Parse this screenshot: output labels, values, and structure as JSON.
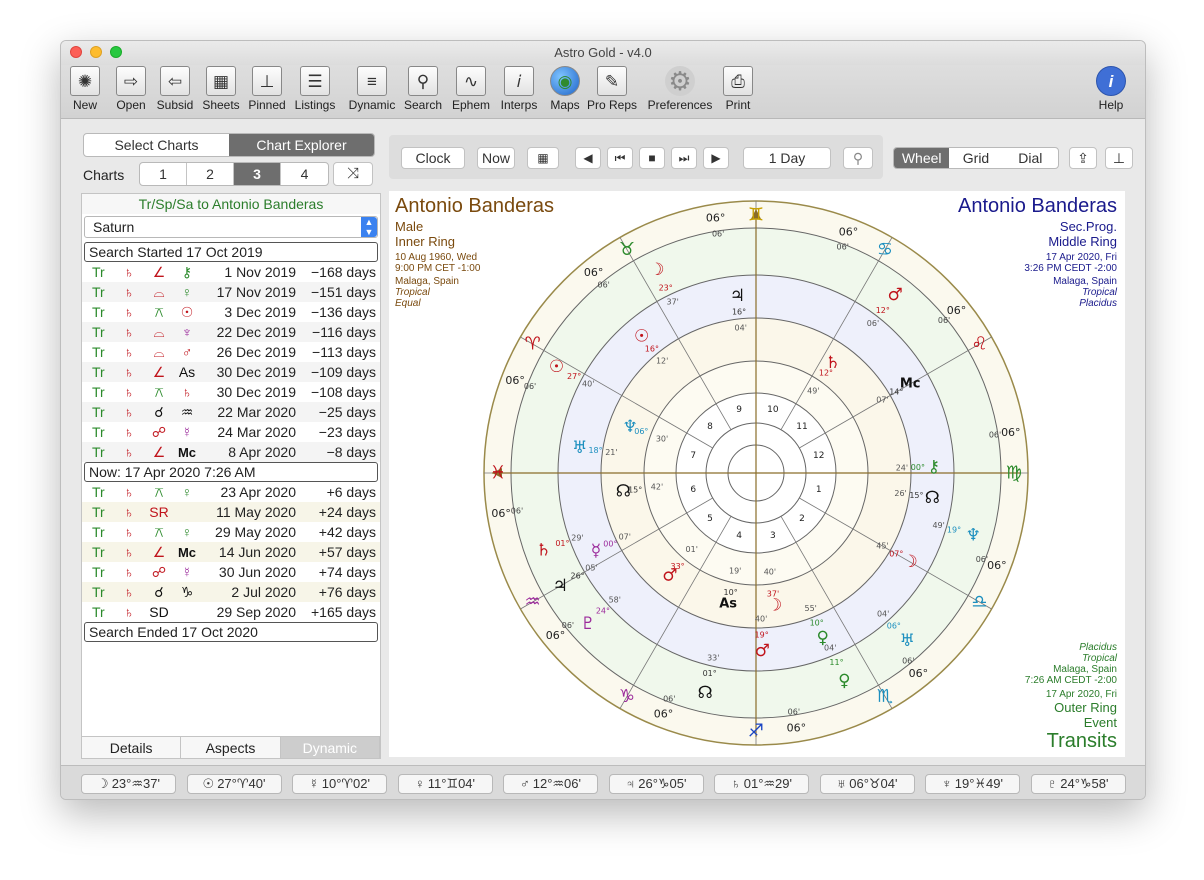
{
  "window_title": "Astro Gold - v4.0",
  "toolbar": [
    {
      "label": "New",
      "icon": "new-chart-icon"
    },
    {
      "label": "Open",
      "icon": "open-icon"
    },
    {
      "label": "Subsid",
      "icon": "subsid-icon"
    },
    {
      "label": "Sheets",
      "icon": "sheets-icon"
    },
    {
      "label": "Pinned",
      "icon": "pin-icon"
    },
    {
      "label": "Listings",
      "icon": "listings-icon"
    },
    {
      "label": "Dynamic",
      "icon": "dynamic-icon"
    },
    {
      "label": "Search",
      "icon": "search-icon"
    },
    {
      "label": "Ephem",
      "icon": "ephem-icon"
    },
    {
      "label": "Interps",
      "icon": "interps-icon"
    },
    {
      "label": "Maps",
      "icon": "globe-icon"
    },
    {
      "label": "Pro Reps",
      "icon": "quill-icon"
    },
    {
      "label": "Preferences",
      "icon": "gear-icon"
    },
    {
      "label": "Print",
      "icon": "printer-icon"
    },
    {
      "label": "Help",
      "icon": "help-icon"
    }
  ],
  "left_tabs": {
    "select": "Select Charts",
    "explorer": "Chart Explorer"
  },
  "charts_label": "Charts",
  "chart_numbers": [
    "1",
    "2",
    "3",
    "4"
  ],
  "active_chart": "3",
  "list_title": "Tr/Sp/Sa to Antonio Banderas",
  "planet_select": "Saturn",
  "search_started": "Search Started 17 Oct 2019",
  "past_events": [
    {
      "tr": "Tr",
      "pl": "♄",
      "asp": "∠",
      "tgt": "⚷",
      "date": "1 Nov 2019",
      "days": "−168 days",
      "asp_color": "#c0131b",
      "tgt_color": "#2b8a2b"
    },
    {
      "tr": "Tr",
      "pl": "♄",
      "asp": "⌓",
      "tgt": "♀",
      "date": "17 Nov 2019",
      "days": "−151 days",
      "asp_color": "#c0131b",
      "tgt_color": "#2b8a2b"
    },
    {
      "tr": "Tr",
      "pl": "♄",
      "asp": "⚻",
      "tgt": "☉",
      "date": "3 Dec 2019",
      "days": "−136 days",
      "asp_color": "#2b8a2b",
      "tgt_color": "#c0131b"
    },
    {
      "tr": "Tr",
      "pl": "♄",
      "asp": "⌓",
      "tgt": "♆",
      "date": "22 Dec 2019",
      "days": "−116 days",
      "asp_color": "#c0131b",
      "tgt_color": "#9b2a9b"
    },
    {
      "tr": "Tr",
      "pl": "♄",
      "asp": "⌓",
      "tgt": "♂",
      "date": "26 Dec 2019",
      "days": "−113 days",
      "asp_color": "#c0131b",
      "tgt_color": "#c0131b"
    },
    {
      "tr": "Tr",
      "pl": "♄",
      "asp": "∠",
      "tgt": "As",
      "date": "30 Dec 2019",
      "days": "−109 days",
      "asp_color": "#c0131b",
      "tgt_color": "#111"
    },
    {
      "tr": "Tr",
      "pl": "♄",
      "asp": "⚻",
      "tgt": "♄",
      "date": "30 Dec 2019",
      "days": "−108 days",
      "asp_color": "#2b8a2b",
      "tgt_color": "#c0131b"
    },
    {
      "tr": "Tr",
      "pl": "♄",
      "asp": "☌",
      "tgt": "♒",
      "date": "22 Mar 2020",
      "days": "−25 days",
      "asp_color": "#111",
      "tgt_color": "#111"
    },
    {
      "tr": "Tr",
      "pl": "♄",
      "asp": "☍",
      "tgt": "☿",
      "date": "24 Mar 2020",
      "days": "−23 days",
      "asp_color": "#c0131b",
      "tgt_color": "#9b2a9b"
    },
    {
      "tr": "Tr",
      "pl": "♄",
      "asp": "∠",
      "tgt": "Mc",
      "date": "8 Apr 2020",
      "days": "−8 days",
      "asp_color": "#c0131b",
      "tgt_color": "#111"
    }
  ],
  "now_line": "Now: 17 Apr 2020 7:26 AM",
  "future_events": [
    {
      "tr": "Tr",
      "pl": "♄",
      "asp": "⚻",
      "tgt": "♀",
      "date": "23 Apr 2020",
      "days": "+6 days",
      "asp_color": "#2b8a2b",
      "tgt_color": "#2b8a2b"
    },
    {
      "tr": "Tr",
      "pl": "♄",
      "asp": "SR",
      "tgt": "",
      "date": "11 May 2020",
      "days": "+24 days",
      "asp_color": "#c0131b",
      "tgt_color": "#111"
    },
    {
      "tr": "Tr",
      "pl": "♄",
      "asp": "⚻",
      "tgt": "♀",
      "date": "29 May 2020",
      "days": "+42 days",
      "asp_color": "#2b8a2b",
      "tgt_color": "#2b8a2b"
    },
    {
      "tr": "Tr",
      "pl": "♄",
      "asp": "∠",
      "tgt": "Mc",
      "date": "14 Jun 2020",
      "days": "+57 days",
      "asp_color": "#c0131b",
      "tgt_color": "#111"
    },
    {
      "tr": "Tr",
      "pl": "♄",
      "asp": "☍",
      "tgt": "☿",
      "date": "30 Jun 2020",
      "days": "+74 days",
      "asp_color": "#c0131b",
      "tgt_color": "#9b2a9b"
    },
    {
      "tr": "Tr",
      "pl": "♄",
      "asp": "☌",
      "tgt": "♑",
      "date": "2 Jul 2020",
      "days": "+76 days",
      "asp_color": "#111",
      "tgt_color": "#111"
    },
    {
      "tr": "Tr",
      "pl": "♄",
      "asp": "SD",
      "tgt": "",
      "date": "29 Sep 2020",
      "days": "+165 days",
      "asp_color": "#111",
      "tgt_color": "#111"
    }
  ],
  "search_ended": "Search Ended 17 Oct 2020",
  "bottom_tabs": [
    "Details",
    "Aspects",
    "Dynamic"
  ],
  "nav": {
    "clock": "Clock",
    "now": "Now",
    "step": "1 Day"
  },
  "view_tabs": [
    "Wheel",
    "Grid",
    "Dial"
  ],
  "chart_left": {
    "name": "Antonio Banderas",
    "gender": "Male",
    "ring": "Inner Ring",
    "date": "10 Aug 1960, Wed",
    "time": "9:00 PM CET -1:00",
    "place": "Malaga, Spain",
    "zodiac": "Tropical",
    "houses": "Equal"
  },
  "chart_right": {
    "name": "Antonio Banderas",
    "type": "Sec.Prog.",
    "ring": "Middle Ring",
    "date": "17 Apr 2020, Fri",
    "time": "3:26 PM CEDT -2:00",
    "place": "Malaga, Spain",
    "zodiac": "Tropical",
    "houses": "Placidus"
  },
  "chart_bottom": {
    "houses": "Placidus",
    "zodiac": "Tropical",
    "place": "Malaga, Spain",
    "time": "7:26 AM CEDT -2:00",
    "date": "17 Apr 2020, Fri",
    "ring": "Outer Ring",
    "type": "Event",
    "title": "Transits"
  },
  "wheel": {
    "signs": [
      {
        "glyph": "♓",
        "color": "#c0131b"
      },
      {
        "glyph": "♈",
        "color": "#c0131b"
      },
      {
        "glyph": "♉",
        "color": "#2b8a2b"
      },
      {
        "glyph": "♊",
        "color": "#c8a100"
      },
      {
        "glyph": "♋",
        "color": "#1c8fbf"
      },
      {
        "glyph": "♌",
        "color": "#c0131b"
      },
      {
        "glyph": "♍",
        "color": "#2b8a2b"
      },
      {
        "glyph": "♎",
        "color": "#1c8fbf"
      },
      {
        "glyph": "♏",
        "color": "#1c8fbf"
      },
      {
        "glyph": "♐",
        "color": "#1a45c4"
      },
      {
        "glyph": "♑",
        "color": "#9b2a9b"
      },
      {
        "glyph": "♒",
        "color": "#9b2a9b"
      }
    ],
    "cusp_label": "06°",
    "cusp_minutes": "06'",
    "house_numbers": [
      "1",
      "2",
      "3",
      "4",
      "5",
      "6",
      "7",
      "8",
      "9",
      "10",
      "11",
      "12"
    ],
    "outer_planets": [
      {
        "glyph": "☊",
        "deg": "01°",
        "min": "33'",
        "color": "#111"
      },
      {
        "glyph": "♇",
        "deg": "24°",
        "min": "58'",
        "color": "#9b2a9b"
      },
      {
        "glyph": "♃",
        "deg": "26°",
        "min": "05'",
        "color": "#111"
      },
      {
        "glyph": "♄",
        "deg": "01°",
        "min": "29'",
        "color": "#c0131b"
      },
      {
        "glyph": "♀",
        "deg": "11°",
        "min": "04'",
        "color": "#2b8a2b"
      },
      {
        "glyph": "♅",
        "deg": "06°",
        "min": "04'",
        "color": "#1c8fbf"
      },
      {
        "glyph": "♆",
        "deg": "19°",
        "min": "49'",
        "color": "#1c8fbf"
      },
      {
        "glyph": "♂",
        "deg": "12°",
        "min": "06'",
        "color": "#c0131b"
      },
      {
        "glyph": "☉",
        "deg": "27°",
        "min": "40'",
        "color": "#c0131b"
      },
      {
        "glyph": "☽",
        "deg": "23°",
        "min": "37'",
        "color": "#c0131b"
      }
    ],
    "middle_planets": [
      {
        "glyph": "♃",
        "deg": "16°",
        "min": "04'",
        "color": "#111"
      },
      {
        "glyph": "Mc",
        "deg": "14°",
        "min": "07'",
        "color": "#111"
      },
      {
        "glyph": "⚷",
        "deg": "00°",
        "min": "24'",
        "color": "#2b8a2b"
      },
      {
        "glyph": "☊",
        "deg": "15°",
        "min": "26'",
        "color": "#111"
      },
      {
        "glyph": "☽",
        "deg": "07°",
        "min": "45'",
        "color": "#c0131b"
      },
      {
        "glyph": "♂",
        "deg": "19°",
        "min": "40'",
        "color": "#c0131b"
      },
      {
        "glyph": "♀",
        "deg": "10°",
        "min": "55'",
        "color": "#2b8a2b"
      },
      {
        "glyph": "☿",
        "deg": "00°",
        "min": "07'",
        "color": "#9b2a9b"
      },
      {
        "glyph": "♅",
        "deg": "18°",
        "min": "21'",
        "color": "#1c8fbf"
      },
      {
        "glyph": "☉",
        "deg": "16°",
        "min": "12'",
        "color": "#c0131b"
      }
    ],
    "inner_planets": [
      {
        "glyph": "☊",
        "deg": "15°",
        "min": "42'",
        "color": "#111"
      },
      {
        "glyph": "♆",
        "deg": "06°",
        "min": "30'",
        "color": "#1c8fbf"
      },
      {
        "glyph": "As",
        "deg": "10°",
        "min": "19'",
        "color": "#111"
      },
      {
        "glyph": "☽",
        "deg": "37'",
        "min": "40'",
        "color": "#c0131b"
      },
      {
        "glyph": "♂",
        "deg": "33°",
        "min": "01'",
        "color": "#c0131b"
      },
      {
        "glyph": "♄",
        "deg": "12°",
        "min": "49'",
        "color": "#c0131b"
      }
    ]
  },
  "status_positions": [
    {
      "glyph": "☽",
      "text": "23°♒37'"
    },
    {
      "glyph": "☉",
      "text": "27°♈40'"
    },
    {
      "glyph": "☿",
      "text": "10°♈02'"
    },
    {
      "glyph": "♀",
      "text": "11°♊04'"
    },
    {
      "glyph": "♂",
      "text": "12°♒06'"
    },
    {
      "glyph": "♃",
      "text": "26°♑05'"
    },
    {
      "glyph": "♄",
      "text": "01°♒29'"
    },
    {
      "glyph": "♅",
      "text": "06°♉04'"
    },
    {
      "glyph": "♆",
      "text": "19°♓49'"
    },
    {
      "glyph": "♇",
      "text": "24°♑58'"
    }
  ]
}
